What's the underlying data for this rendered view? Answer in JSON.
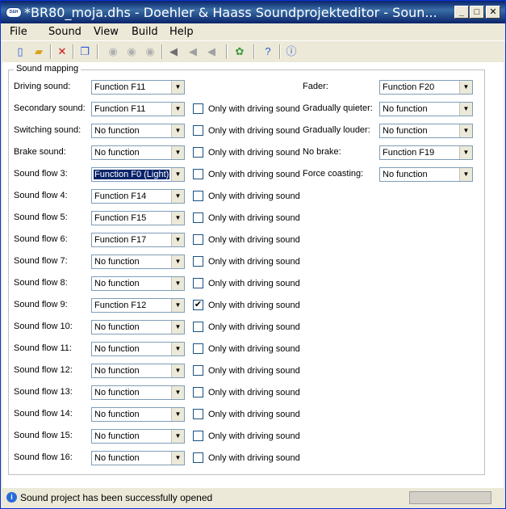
{
  "window": {
    "title": "*BR80_moja.dhs - Doehler & Haass Soundprojekteditor - Soun...",
    "app_icon_text": "D&H",
    "minimize": "_",
    "maximize": "□",
    "close": "✕"
  },
  "menu": [
    "File",
    "Sound",
    "View",
    "Build",
    "Help"
  ],
  "toolbar_icons": [
    "new-file-icon",
    "open-folder-icon",
    "delete-icon",
    "copy-icon",
    "play-icon",
    "pause-icon",
    "stop-icon",
    "volume-on-icon",
    "volume-mute-icon",
    "volume-low-icon",
    "settings-gear-icon",
    "help-icon",
    "info-icon"
  ],
  "group": {
    "title": "Sound mapping"
  },
  "checkbox_label": "Only with driving sound",
  "left_rows": [
    {
      "label": "Driving sound:",
      "value": "Function F11",
      "has_checkbox": false,
      "checked": false
    },
    {
      "label": "Secondary sound:",
      "value": "Function F11",
      "has_checkbox": true,
      "checked": false
    },
    {
      "label": "Switching sound:",
      "value": "No function",
      "has_checkbox": true,
      "checked": false
    },
    {
      "label": "Brake sound:",
      "value": "No function",
      "has_checkbox": true,
      "checked": false
    },
    {
      "label": "Sound flow 3:",
      "value": "Function F0 (Light)",
      "has_checkbox": true,
      "checked": false,
      "focused": true
    },
    {
      "label": "Sound flow 4:",
      "value": "Function F14",
      "has_checkbox": true,
      "checked": false
    },
    {
      "label": "Sound flow 5:",
      "value": "Function F15",
      "has_checkbox": true,
      "checked": false
    },
    {
      "label": "Sound flow 6:",
      "value": "Function F17",
      "has_checkbox": true,
      "checked": false
    },
    {
      "label": "Sound flow 7:",
      "value": "No function",
      "has_checkbox": true,
      "checked": false
    },
    {
      "label": "Sound flow 8:",
      "value": "No function",
      "has_checkbox": true,
      "checked": false
    },
    {
      "label": "Sound flow 9:",
      "value": "Function F12",
      "has_checkbox": true,
      "checked": true
    },
    {
      "label": "Sound flow 10:",
      "value": "No function",
      "has_checkbox": true,
      "checked": false
    },
    {
      "label": "Sound flow 11:",
      "value": "No function",
      "has_checkbox": true,
      "checked": false
    },
    {
      "label": "Sound flow 12:",
      "value": "No function",
      "has_checkbox": true,
      "checked": false
    },
    {
      "label": "Sound flow 13:",
      "value": "No function",
      "has_checkbox": true,
      "checked": false
    },
    {
      "label": "Sound flow 14:",
      "value": "No function",
      "has_checkbox": true,
      "checked": false
    },
    {
      "label": "Sound flow 15:",
      "value": "No function",
      "has_checkbox": true,
      "checked": false
    },
    {
      "label": "Sound flow 16:",
      "value": "No function",
      "has_checkbox": true,
      "checked": false
    }
  ],
  "right_rows": [
    {
      "label": "Fader:",
      "value": "Function F20"
    },
    {
      "label": "Gradually quieter:",
      "value": "No function"
    },
    {
      "label": "Gradually louder:",
      "value": "No function"
    },
    {
      "label": "No brake:",
      "value": "Function F19"
    },
    {
      "label": "Force coasting:",
      "value": "No function"
    }
  ],
  "status": {
    "text": "Sound project has been successfully opened"
  },
  "colors": {
    "title_bar": "#0a246a",
    "selection": "#0a246a",
    "window_bg": "#ece9d8"
  }
}
